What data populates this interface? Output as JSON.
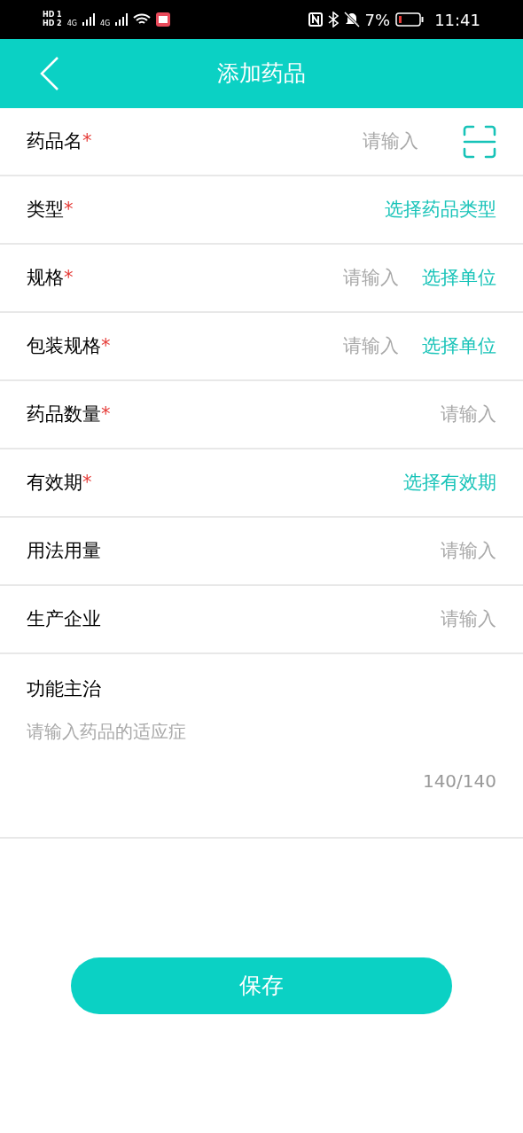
{
  "status_bar": {
    "sim1": "HD 1",
    "sim2": "HD 2",
    "net1": "4G",
    "net2": "4G",
    "battery": "7%",
    "time": "11:41"
  },
  "header": {
    "title": "添加药品"
  },
  "required_mark": "*",
  "rows": [
    {
      "label": "药品名",
      "required": true,
      "controls": [
        {
          "kind": "input",
          "placeholder": "请输入"
        },
        {
          "kind": "scan"
        }
      ]
    },
    {
      "label": "类型",
      "required": true,
      "controls": [
        {
          "kind": "select",
          "text": "选择药品类型"
        }
      ]
    },
    {
      "label": "规格",
      "required": true,
      "controls": [
        {
          "kind": "input",
          "placeholder": "请输入"
        },
        {
          "kind": "select",
          "text": "选择单位"
        }
      ]
    },
    {
      "label": "包装规格",
      "required": true,
      "controls": [
        {
          "kind": "input",
          "placeholder": "请输入"
        },
        {
          "kind": "select",
          "text": "选择单位"
        }
      ]
    },
    {
      "label": "药品数量",
      "required": true,
      "controls": [
        {
          "kind": "input",
          "placeholder": "请输入"
        }
      ]
    },
    {
      "label": "有效期",
      "required": true,
      "controls": [
        {
          "kind": "select",
          "text": "选择有效期"
        }
      ]
    },
    {
      "label": "用法用量",
      "required": false,
      "controls": [
        {
          "kind": "input",
          "placeholder": "请输入"
        }
      ]
    },
    {
      "label": "生产企业",
      "required": false,
      "controls": [
        {
          "kind": "input",
          "placeholder": "请输入"
        }
      ]
    }
  ],
  "indications": {
    "label": "功能主治",
    "placeholder": "请输入药品的适应症",
    "counter": "140/140"
  },
  "save_button": "保存"
}
